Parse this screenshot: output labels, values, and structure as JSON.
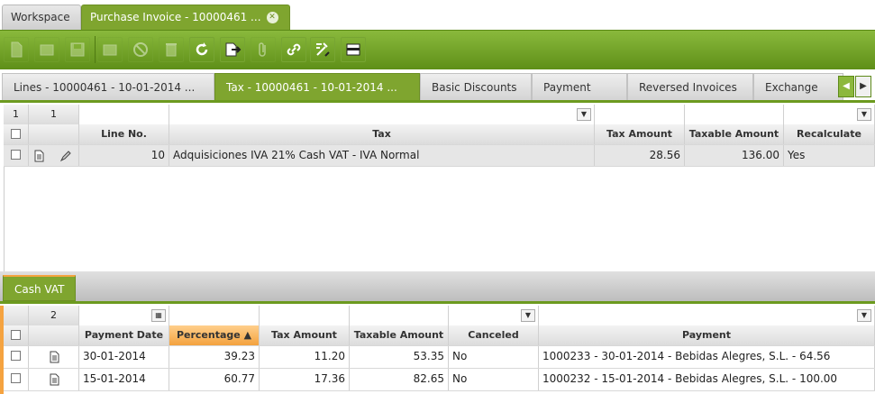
{
  "top_tabs": {
    "workspace": "Workspace",
    "active": "Purchase Invoice - 10000461 ...",
    "close_symbol": "✕"
  },
  "toolbar": {
    "buttons": [
      "new-document",
      "new-row",
      "save",
      "delete-row",
      "undo",
      "delete",
      "refresh",
      "export",
      "attach",
      "link",
      "tools",
      "layout"
    ]
  },
  "sub_tabs": [
    "Lines - 10000461 - 10-01-2014 ...",
    "Tax - 10000461 - 10-01-2014 ...",
    "Basic Discounts",
    "Payment Plan",
    "Reversed Invoices",
    "Exchange rat"
  ],
  "tax_grid": {
    "count_left": "1",
    "count_right": "1",
    "headers": [
      "Line No.",
      "Tax",
      "Tax Amount",
      "Taxable Amount",
      "Recalculate"
    ],
    "rows": [
      {
        "line_no": "10",
        "tax": "Adquisiciones IVA 21% Cash VAT - IVA Normal",
        "tax_amount": "28.56",
        "taxable_amount": "136.00",
        "recalculate": "Yes"
      }
    ]
  },
  "cash_vat_tab": "Cash VAT",
  "cash_vat_grid": {
    "count": "2",
    "headers": [
      "Payment Date",
      "Percentage",
      "Tax Amount",
      "Taxable Amount",
      "Canceled",
      "Payment"
    ],
    "sort_indicator": "▲",
    "rows": [
      {
        "payment_date": "30-01-2014",
        "percentage": "39.23",
        "tax_amount": "11.20",
        "taxable_amount": "53.35",
        "canceled": "No",
        "payment": "1000233 - 30-01-2014 - Bebidas Alegres, S.L. - 64.56"
      },
      {
        "payment_date": "15-01-2014",
        "percentage": "60.77",
        "tax_amount": "17.36",
        "taxable_amount": "82.65",
        "canceled": "No",
        "payment": "1000232 - 15-01-2014 - Bebidas Alegres, S.L. - 100.00"
      }
    ]
  },
  "colors": {
    "accent": "#7fa52f",
    "toolbar": "#6c9a1f",
    "sort": "#f3a23e"
  }
}
